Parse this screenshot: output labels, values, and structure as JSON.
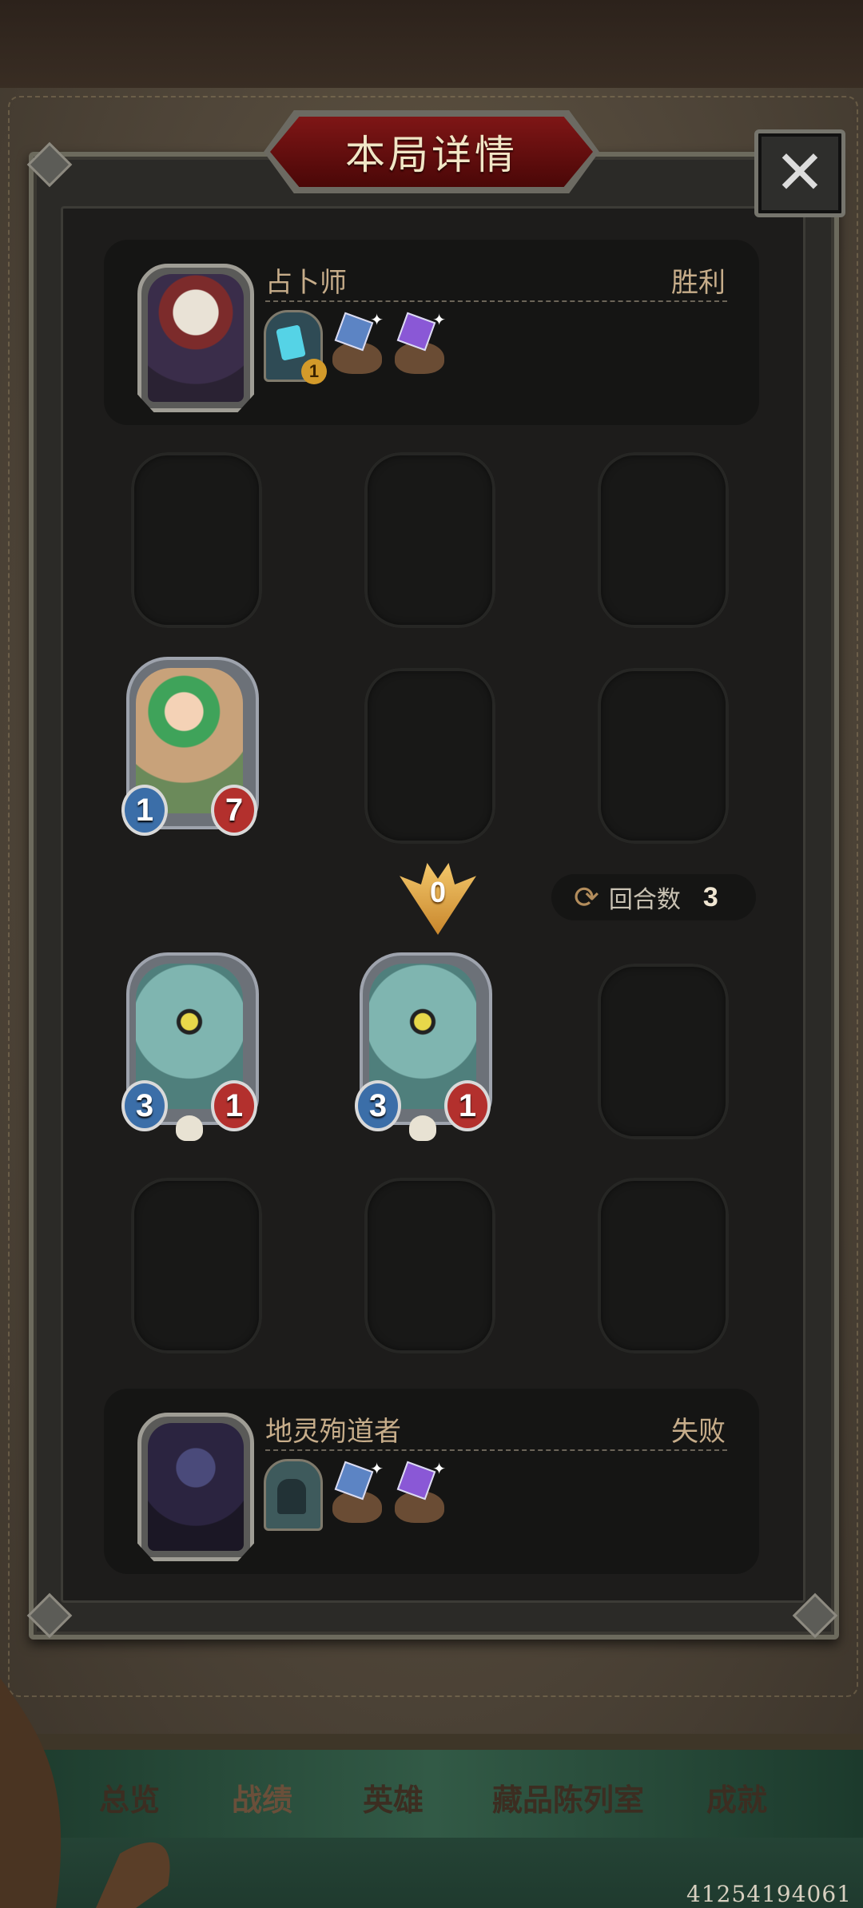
{
  "dialog": {
    "title": "本局详情",
    "close_label": "✕"
  },
  "top_player": {
    "name": "占卜师",
    "result": "胜利",
    "trinket_level": "1"
  },
  "bottom_player": {
    "name": "地灵殉道者",
    "result": "失败"
  },
  "board": {
    "minions": [
      {
        "attack": "1",
        "health": "7"
      },
      {
        "attack": "3",
        "health": "1"
      },
      {
        "attack": "3",
        "health": "1"
      }
    ],
    "marker_value": "0",
    "turn_label": "回合数",
    "turn_count": "3"
  },
  "nav": {
    "tabs": [
      "总览",
      "战绩",
      "英雄",
      "藏品陈列室",
      "成就"
    ],
    "active_tab": "战绩"
  },
  "user_id": "41254194061",
  "colors": {
    "title_red": "#7f1616",
    "result_text": "#c7ad8a",
    "attack_blue": "#3b6ea8",
    "health_red": "#b3302d"
  }
}
